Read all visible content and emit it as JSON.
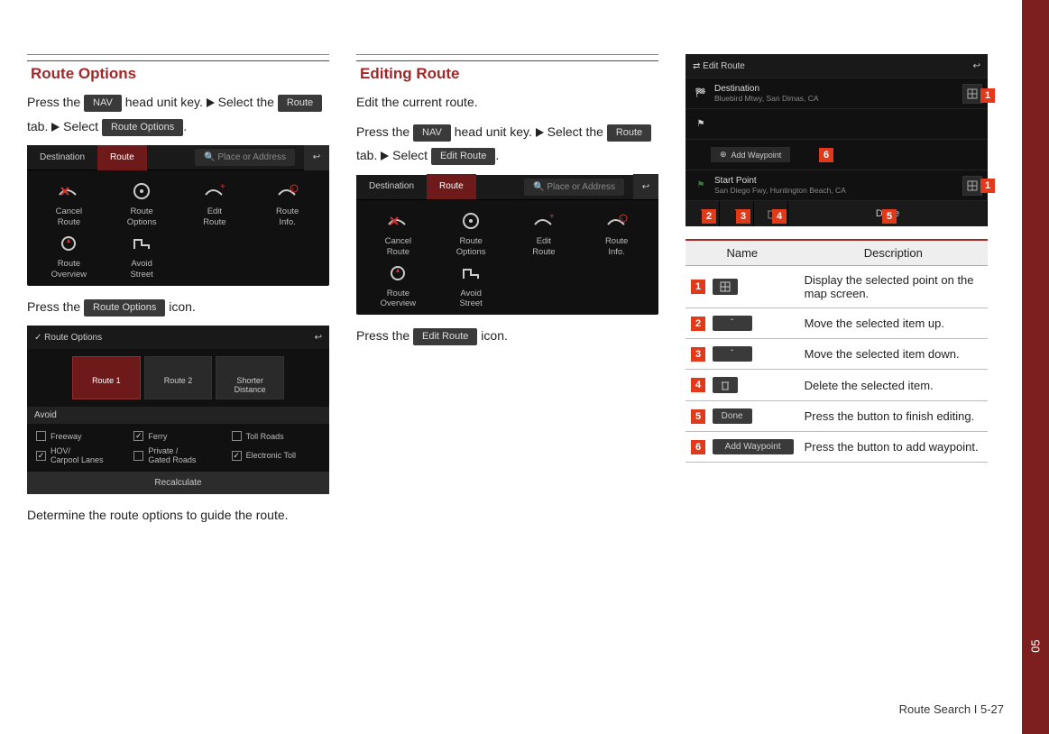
{
  "chapter_tab": "05",
  "footer": "Route Search I 5-27",
  "tri_glyph": "▶",
  "col1": {
    "heading": "Route Options",
    "intro_parts": {
      "p1a": "Press the ",
      "chip_nav": "NAV",
      "p1b": " head unit key. ",
      "p1c": " Select the ",
      "chip_route": "Route",
      "p1d": " tab. ",
      "p1e": " Select ",
      "chip_ropt": "Route Options",
      "p1f": "."
    },
    "shot1": {
      "tab_dest": "Destination",
      "tab_route": "Route",
      "search_placeholder": "Place or Address",
      "cells": [
        "Cancel\nRoute",
        "Route\nOptions",
        "Edit\nRoute",
        "Route\nInfo.",
        "Route\nOverview",
        "Avoid\nStreet"
      ]
    },
    "line2a": "Press the ",
    "line2_chip": "Route Options",
    "line2b": " icon.",
    "shot2": {
      "title": "Route Options",
      "routes": [
        "Route 1",
        "Route 2",
        "Shorter\nDistance"
      ],
      "avoid_label": "Avoid",
      "checks": [
        {
          "label": "Freeway",
          "on": false
        },
        {
          "label": "Ferry",
          "on": true
        },
        {
          "label": "Toll Roads",
          "on": false
        },
        {
          "label": "HOV/\nCarpool Lanes",
          "on": true
        },
        {
          "label": "Private /\nGated Roads",
          "on": false
        },
        {
          "label": "Electronic Toll",
          "on": true
        }
      ],
      "recalc": "Recalculate"
    },
    "line3": "Determine the route options to guide the route."
  },
  "col2": {
    "heading": "Editing Route",
    "line1": "Edit the current route.",
    "intro_parts": {
      "p1a": "Press the ",
      "chip_nav": "NAV",
      "p1b": " head unit key. ",
      "p1c": " Select the ",
      "chip_route": "Route",
      "p1d": " tab. ",
      "p1e": " Select ",
      "chip_edit": "Edit Route",
      "p1f": "."
    },
    "shot1": {
      "tab_dest": "Destination",
      "tab_route": "Route",
      "search_placeholder": "Place or Address",
      "cells": [
        "Cancel\nRoute",
        "Route\nOptions",
        "Edit\nRoute",
        "Route\nInfo.",
        "Route\nOverview",
        "Avoid\nStreet"
      ]
    },
    "line2a": "Press the ",
    "line2_chip": "Edit Route",
    "line2b": " icon."
  },
  "col3": {
    "editshot": {
      "title": "Edit Route",
      "dest_label": "Destination",
      "dest_sub": "Bluebird Mtwy, San Dimas, CA",
      "add_wp": "Add Waypoint",
      "start_label": "Start Point",
      "start_sub": "San Diego Fwy, Huntington Beach, CA",
      "done": "Done"
    },
    "table": {
      "h1": "Name",
      "h2": "Description",
      "rows": [
        {
          "n": "1",
          "chip_type": "map",
          "desc": "Display the selected point on the map screen."
        },
        {
          "n": "2",
          "chip_type": "up",
          "desc": "Move the selected item up."
        },
        {
          "n": "3",
          "chip_type": "down",
          "desc": "Move the selected item down."
        },
        {
          "n": "4",
          "chip_type": "trash",
          "desc": "Delete the selected item."
        },
        {
          "n": "5",
          "chip_type": "done",
          "chip_label": "Done",
          "desc": "Press the button to finish editing."
        },
        {
          "n": "6",
          "chip_type": "addwp",
          "chip_label": "Add Waypoint",
          "desc": "Press the button to add waypoint."
        }
      ]
    }
  }
}
